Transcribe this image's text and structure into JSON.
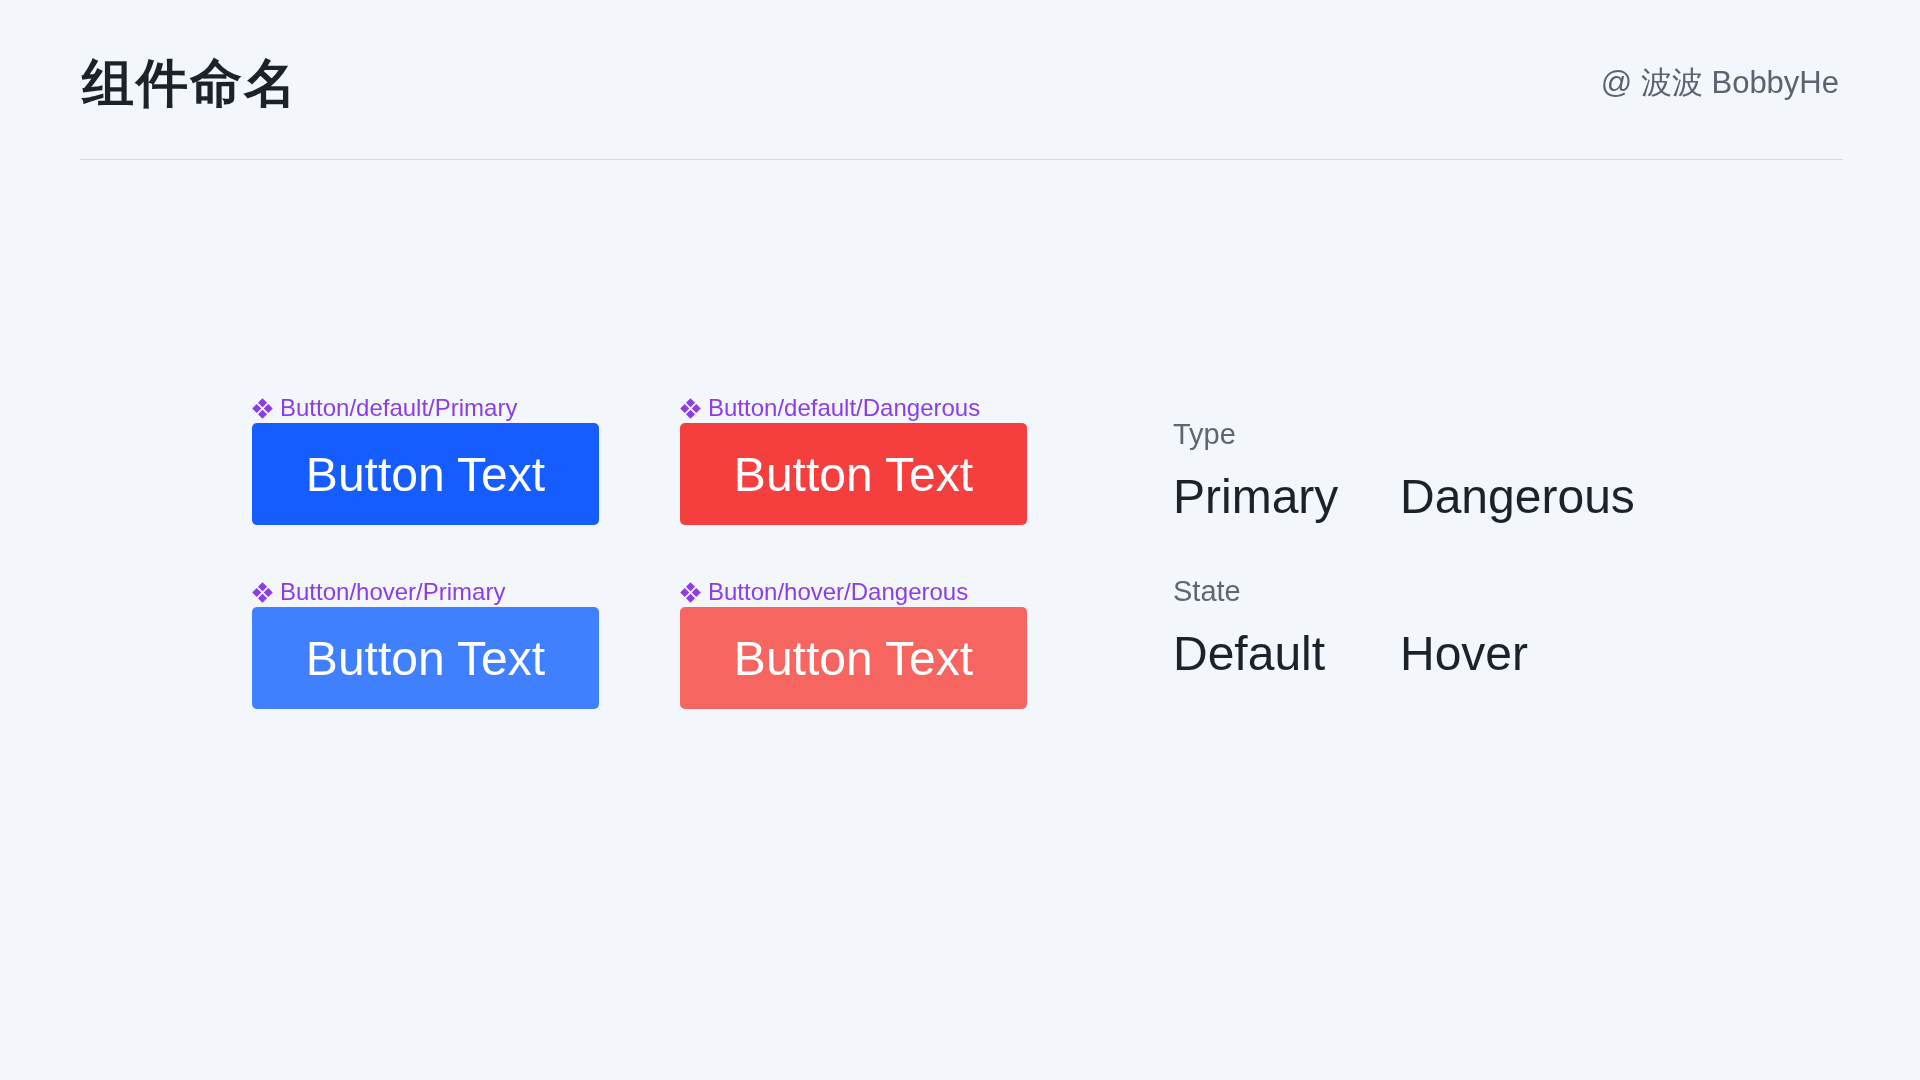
{
  "header": {
    "title": "组件命名",
    "author": "@ 波波 BobbyHe"
  },
  "components": [
    {
      "name": "Button/default/Primary",
      "label": "Button Text",
      "color": "#165dff"
    },
    {
      "name": "Button/default/Dangerous",
      "label": "Button Text",
      "color": "#f53f3f"
    },
    {
      "name": "Button/hover/Primary",
      "label": "Button Text",
      "color": "#4080ff"
    },
    {
      "name": "Button/hover/Dangerous",
      "label": "Button Text",
      "color": "#f76560"
    }
  ],
  "legend": [
    {
      "heading": "Type",
      "values": [
        "Primary",
        "Dangerous"
      ]
    },
    {
      "heading": "State",
      "values": [
        "Default",
        "Hover"
      ]
    }
  ]
}
